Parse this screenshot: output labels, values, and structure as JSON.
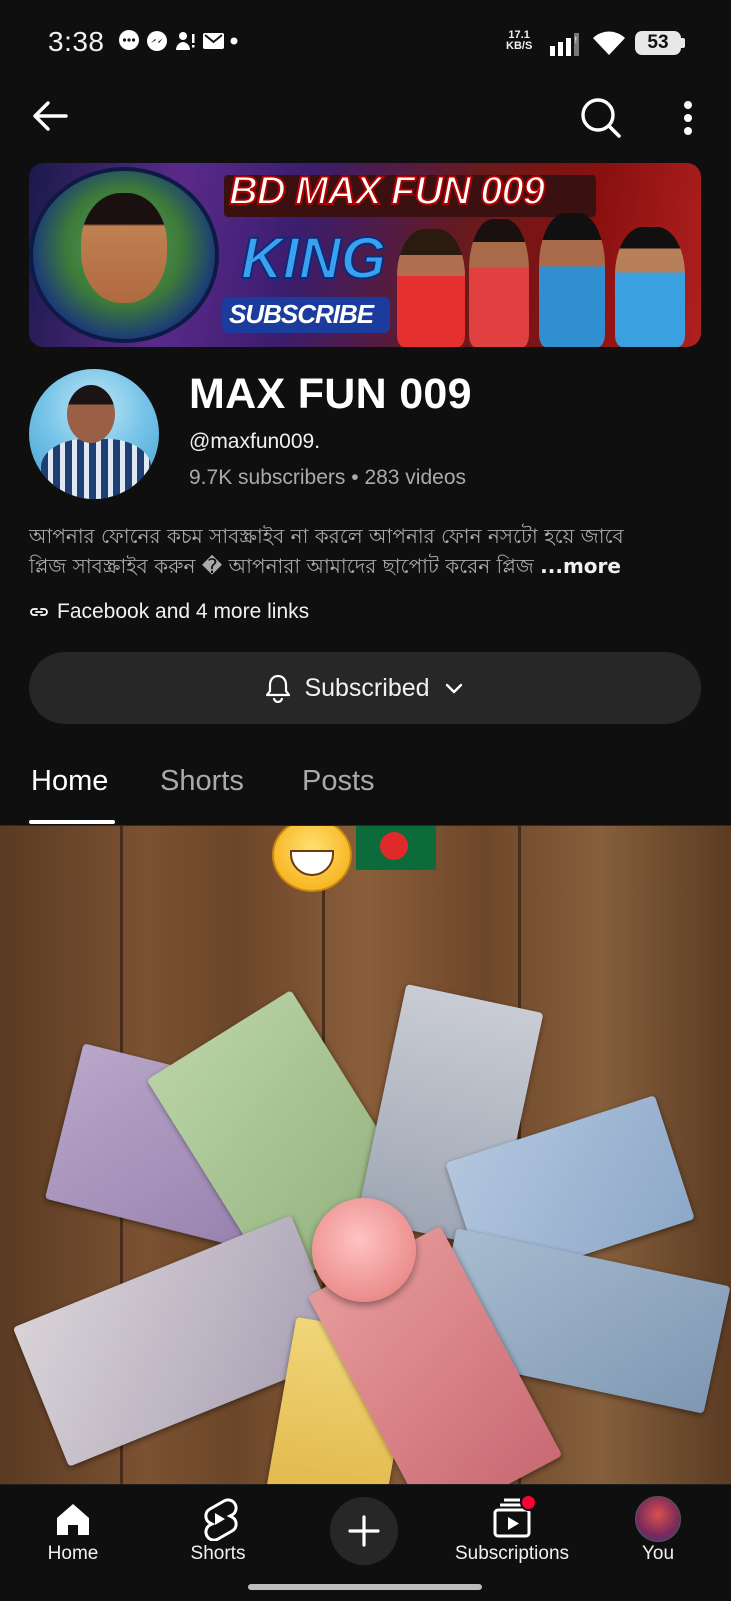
{
  "status_bar": {
    "time": "3:38",
    "net_speed_value": "17.1",
    "net_speed_unit": "KB/S",
    "battery": "53"
  },
  "banner": {
    "title": "BD MAX FUN 009",
    "subtitle": "KING",
    "subscribe": "SUBSCRIBE"
  },
  "channel": {
    "name": "MAX FUN 009",
    "handle": "@maxfun009.",
    "subscribers": "9.7K subscribers",
    "separator": " • ",
    "videos": "283 videos",
    "description_line1": "আপনার ফোনের কচম সাবস্ক্রাইব না করলে আপনার ফোন নসটো হয়ে জাবে",
    "description_line2": "প্লিজ সাবস্ক্রাইব করুন � আপনারা আমাদের  ছাপোট করেন প্লিজ",
    "more_label": "...more",
    "links_label": "Facebook and 4 more links",
    "subscribed_label": "Subscribed"
  },
  "tabs": [
    {
      "label": "Home",
      "active": true
    },
    {
      "label": "Shorts",
      "active": false
    },
    {
      "label": "Posts",
      "active": false
    }
  ],
  "bottom_nav": {
    "home": "Home",
    "shorts": "Shorts",
    "subscriptions": "Subscriptions",
    "you": "You"
  },
  "colors": {
    "background": "#0f0f0f",
    "button_bg": "#272727",
    "secondary_text": "#aaaaaa",
    "notification_dot": "#ff0033"
  }
}
